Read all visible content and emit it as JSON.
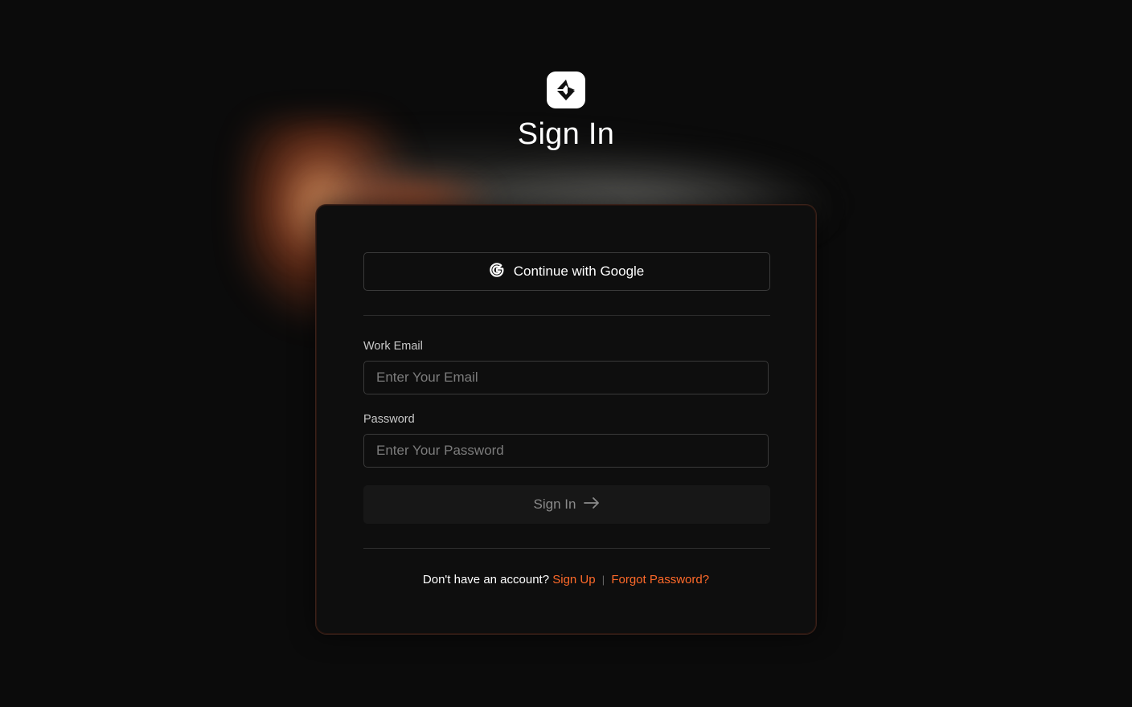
{
  "page": {
    "title": "Sign In"
  },
  "logo": {
    "icon": "brand-logo-icon"
  },
  "google": {
    "label": "Continue with Google",
    "icon": "google-icon"
  },
  "form": {
    "email_label": "Work Email",
    "email_placeholder": "Enter Your Email",
    "email_value": "",
    "password_label": "Password",
    "password_placeholder": "Enter Your Password",
    "password_value": "",
    "submit_label": "Sign In",
    "submit_icon": "arrow-right-icon"
  },
  "footer": {
    "prompt": "Don't have an account?",
    "signup_label": "Sign Up",
    "separator": "|",
    "forgot_label": "Forgot Password?"
  },
  "colors": {
    "background": "#0b0b0b",
    "accent": "#ff6a2a",
    "card_border": "#3a221a"
  }
}
